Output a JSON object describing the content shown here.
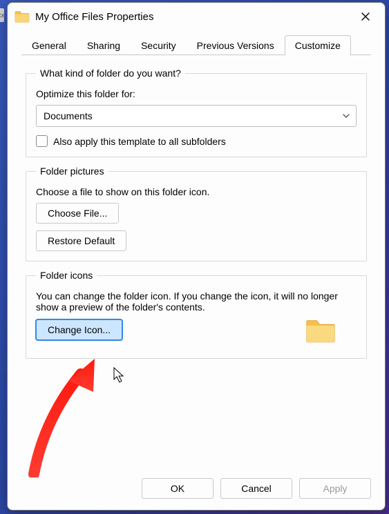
{
  "window": {
    "title": "My Office Files Properties"
  },
  "tabs": {
    "general": "General",
    "sharing": "Sharing",
    "security": "Security",
    "previous": "Previous Versions",
    "customize": "Customize"
  },
  "group_kind": {
    "legend": "What kind of folder do you want?",
    "optimize_label": "Optimize this folder for:",
    "selected": "Documents",
    "apply_sub": "Also apply this template to all subfolders"
  },
  "group_pictures": {
    "legend": "Folder pictures",
    "desc": "Choose a file to show on this folder icon.",
    "choose": "Choose File...",
    "restore": "Restore Default"
  },
  "group_icons": {
    "legend": "Folder icons",
    "desc": "You can change the folder icon. If you change the icon, it will no longer show a preview of the folder's contents.",
    "change": "Change Icon..."
  },
  "footer": {
    "ok": "OK",
    "cancel": "Cancel",
    "apply": "Apply"
  },
  "side_hint": "ce"
}
